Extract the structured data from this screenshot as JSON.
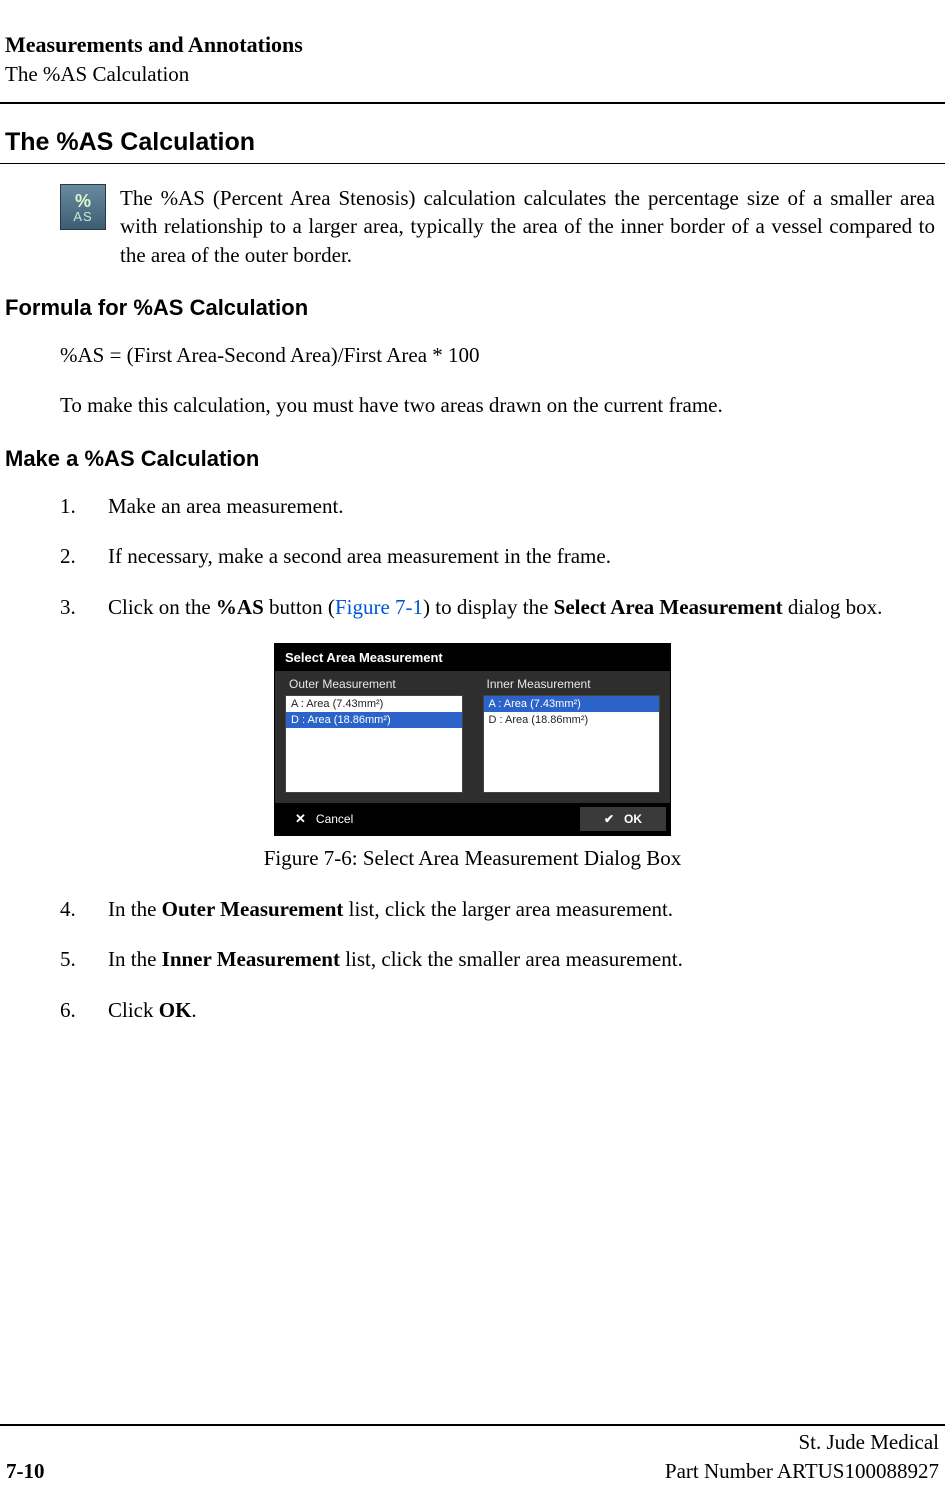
{
  "header": {
    "title": "Measurements and Annotations",
    "subtitle": "The %AS Calculation"
  },
  "section_title": "The %AS Calculation",
  "icon_label_top": "%",
  "icon_label_bottom": "AS",
  "intro_paragraph": "The %AS (Percent Area Stenosis) calculation calculates the percentage size of a smaller area with relationship to a larger area, typically the area of the inner border of a vessel compared to the area of the outer border.",
  "formula": {
    "heading": "Formula for %AS Calculation",
    "equation": "%AS = (First Area-Second Area)/First Area * 100",
    "note": "To make this calculation, you must have two areas drawn on the current frame."
  },
  "make_calc": {
    "heading": "Make a %AS Calculation",
    "steps": {
      "s1": {
        "num": "1.",
        "text": "Make an area measurement."
      },
      "s2": {
        "num": "2.",
        "text": "If necessary, make a second area measurement in the frame."
      },
      "s3": {
        "num": "3.",
        "pre": "Click on the ",
        "bold1": "%AS",
        "mid": " button (",
        "figref": "Figure 7-1",
        "mid2": ") to display the ",
        "bold2": "Select Area Measurement",
        "post": " dialog box."
      },
      "s4": {
        "num": "4.",
        "pre": "In the ",
        "bold": "Outer Measurement",
        "post": " list, click the larger area measurement."
      },
      "s5": {
        "num": "5.",
        "pre": "In the ",
        "bold": "Inner Measurement",
        "post": " list, click the smaller area measurement."
      },
      "s6": {
        "num": "6.",
        "pre": "Click ",
        "bold": "OK",
        "post": "."
      }
    }
  },
  "dialog": {
    "title": "Select Area Measurement",
    "outer_header": "Outer Measurement",
    "inner_header": "Inner Measurement",
    "outer_items": {
      "i0": "A : Area (7.43mm²)",
      "i1": "D : Area (18.86mm²)"
    },
    "inner_items": {
      "i0": "A : Area (7.43mm²)",
      "i1": "D : Area (18.86mm²)"
    },
    "cancel_label": "Cancel",
    "ok_label": "OK"
  },
  "figure_caption": "Figure 7-6:  Select Area Measurement Dialog Box",
  "footer": {
    "company": "St. Jude Medical",
    "page_num": "7-10",
    "part_number": "Part Number ARTUS100088927"
  }
}
